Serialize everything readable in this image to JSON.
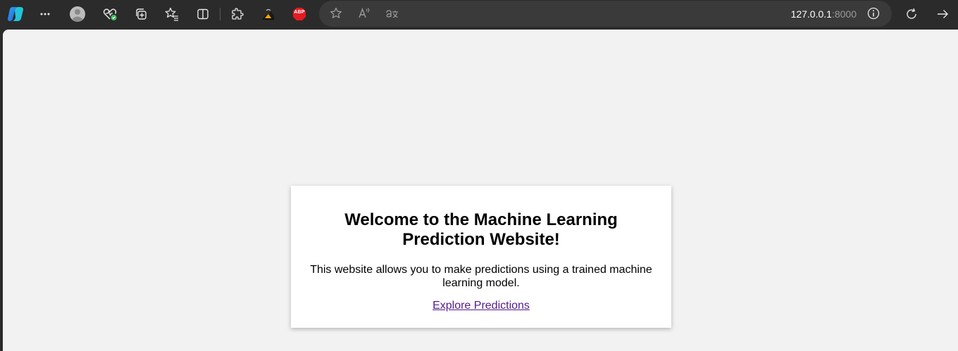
{
  "browser": {
    "address_host": "127.0.0.1",
    "address_port": ":8000",
    "extensions": {
      "abp_label": "ABP"
    },
    "icons": [
      "copilot-icon",
      "more-icon",
      "profile-avatar-icon",
      "health-icon",
      "collections-icon",
      "favorites-list-icon",
      "split-screen-icon",
      "extensions-icon",
      "extension-image-icon",
      "adblock-plus-icon",
      "star-icon",
      "read-aloud-icon",
      "translate-icon",
      "site-info-icon",
      "refresh-icon",
      "forward-icon"
    ],
    "accent_colors": {
      "abp_red": "#e41b23",
      "health_green": "#3fbf5f",
      "link_visited": "#551a8b"
    }
  },
  "page": {
    "heading": "Welcome to the Machine Learning Prediction Website!",
    "description": "This website allows you to make predictions using a trained machine learning model.",
    "link_label": "Explore Predictions"
  }
}
